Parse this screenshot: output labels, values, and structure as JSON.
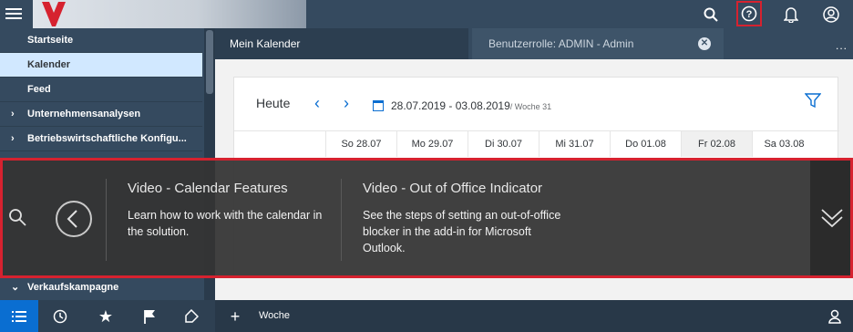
{
  "header": {
    "icons": [
      "menu-icon",
      "search-icon",
      "help-icon",
      "bell-icon",
      "user-icon"
    ],
    "accent": "#d6222f"
  },
  "sidebar": {
    "items": [
      {
        "label": "Startseite",
        "active": false
      },
      {
        "label": "Kalender",
        "active": true
      },
      {
        "label": "Feed",
        "active": false
      },
      {
        "label": "Unternehmensanalysen",
        "expandable": true
      },
      {
        "label": "Betriebswirtschaftliche Konfigu...",
        "expandable": true
      }
    ],
    "footer_item": {
      "label": "Verkaufskampagne",
      "expanded": true
    }
  },
  "tabs": {
    "tab1": "Mein Kalender",
    "tab2": "Benutzerrolle: ADMIN - Admin",
    "more": "..."
  },
  "calendar": {
    "today_label": "Heute",
    "date_range": "28.07.2019 - 03.08.2019",
    "week_label": "/ Woche 31",
    "days": [
      "So 28.07",
      "Mo 29.07",
      "Di 30.07",
      "Mi 31.07",
      "Do 01.08",
      "Fr 02.08",
      "Sa 03.08"
    ],
    "highlighted_day": "Fr 02.08"
  },
  "overlay": {
    "items": [
      {
        "title": "Video - Calendar Features",
        "description": "Learn how to work with the calendar in the solution."
      },
      {
        "title": "Video - Out of Office Indicator",
        "description": "See the steps of setting an out-of-office blocker in the add-in for Microsoft Outlook."
      }
    ]
  },
  "bottombar": {
    "view_label": "Woche"
  }
}
